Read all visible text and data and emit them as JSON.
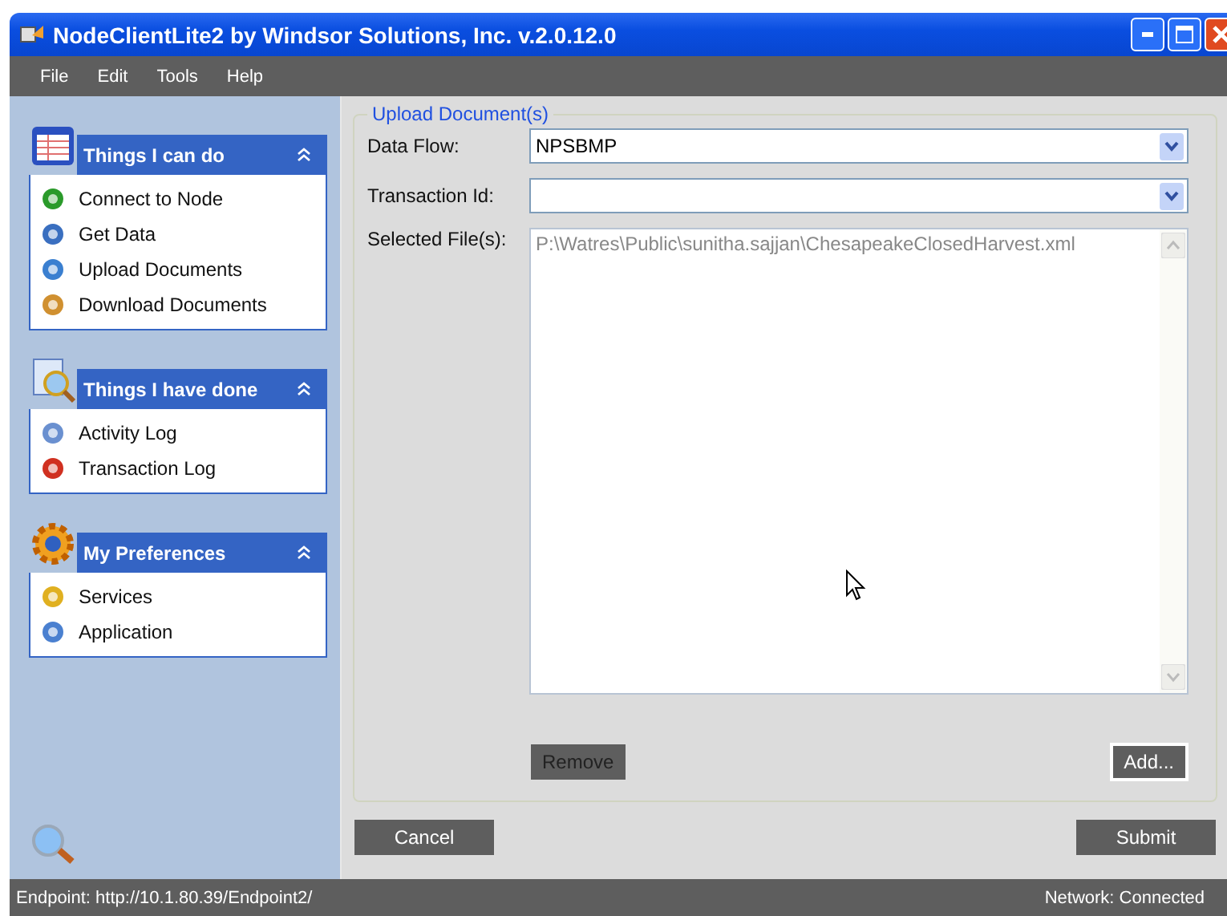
{
  "window": {
    "title": "NodeClientLite2 by Windsor Solutions, Inc. v.2.0.12.0"
  },
  "menu": [
    "File",
    "Edit",
    "Tools",
    "Help"
  ],
  "sidebar": {
    "groups": [
      {
        "title": "Things I can do",
        "expanded": true,
        "items": [
          "Connect to Node",
          "Get Data",
          "Upload Documents",
          "Download Documents"
        ]
      },
      {
        "title": "Things I have done",
        "expanded": true,
        "items": [
          "Activity Log",
          "Transaction Log"
        ]
      },
      {
        "title": "My Preferences",
        "expanded": true,
        "items": [
          "Services",
          "Application"
        ]
      }
    ]
  },
  "form": {
    "legend": "Upload Document(s)",
    "fields": [
      {
        "label": "Data Flow:",
        "kind": "combo",
        "value": "NPSBMP"
      },
      {
        "label": "Transaction Id:",
        "kind": "combo"
      },
      {
        "label": "Selected File(s):",
        "kind": "list",
        "items": [
          "P:\\Watres\\Public\\sunitha.sajjan\\ChesapeakeClosedHarvest.xml"
        ]
      }
    ],
    "list_buttons": [
      {
        "label": "Remove",
        "disabled": true
      },
      {
        "label": "Add...",
        "disabled": false
      }
    ]
  },
  "buttons": [
    "Cancel",
    "Submit"
  ],
  "status_bar": {
    "endpoint": "Endpoint: http://10.1.80.39/Endpoint2/",
    "network": "Network: Connected"
  }
}
